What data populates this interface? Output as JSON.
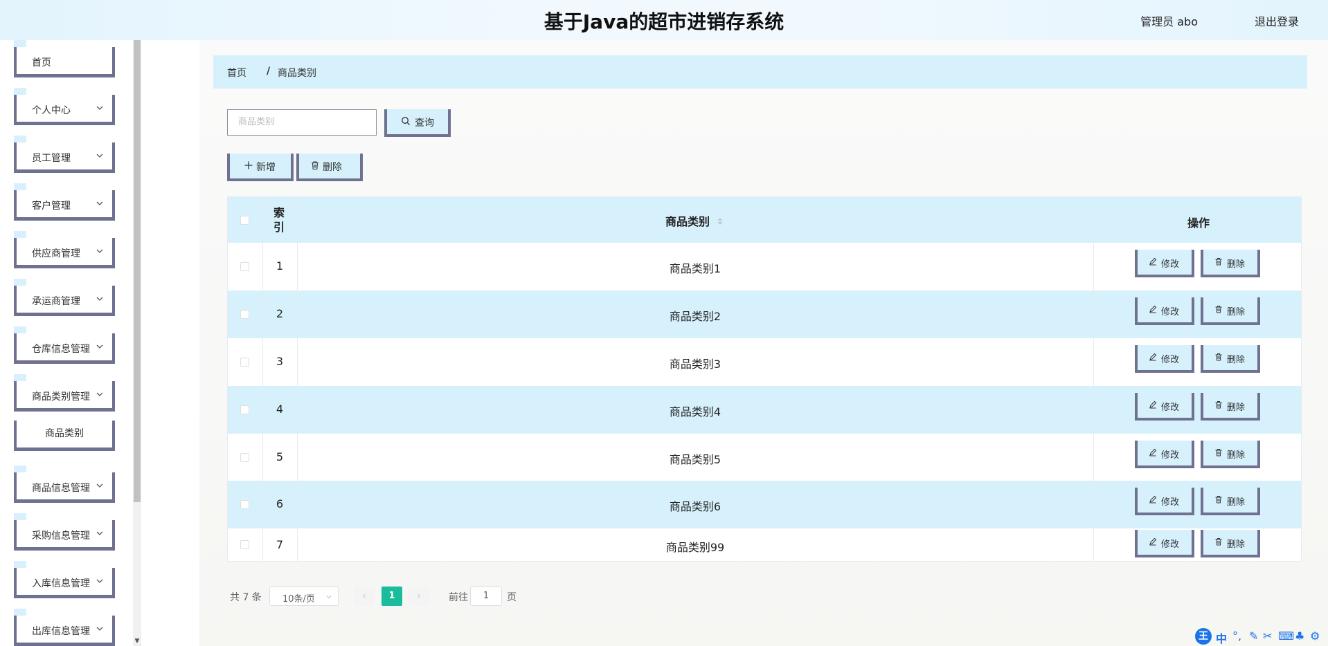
{
  "header": {
    "title": "基于Java的超市进销存系统",
    "user": "管理员 abo",
    "logout": "退出登录"
  },
  "sidebar": {
    "items": [
      {
        "label": "首页"
      },
      {
        "label": "个人中心"
      },
      {
        "label": "员工管理"
      },
      {
        "label": "客户管理"
      },
      {
        "label": "供应商管理"
      },
      {
        "label": "承运商管理"
      },
      {
        "label": "仓库信息管理"
      },
      {
        "label": "商品类别管理"
      },
      {
        "label": "商品类别"
      },
      {
        "label": "商品信息管理"
      },
      {
        "label": "采购信息管理"
      },
      {
        "label": "入库信息管理"
      },
      {
        "label": "出库信息管理"
      }
    ]
  },
  "breadcrumb": {
    "home": "首页",
    "sep": "/",
    "current": "商品类别"
  },
  "search": {
    "placeholder": "商品类别",
    "button": "查询"
  },
  "toolbar": {
    "add": "新增",
    "delete": "删除"
  },
  "table": {
    "headers": {
      "index": "索引",
      "category": "商品类别",
      "actions": "操作"
    },
    "rows": [
      {
        "index": "1",
        "category": "商品类别1"
      },
      {
        "index": "2",
        "category": "商品类别2"
      },
      {
        "index": "3",
        "category": "商品类别3"
      },
      {
        "index": "4",
        "category": "商品类别4"
      },
      {
        "index": "5",
        "category": "商品类别5"
      },
      {
        "index": "6",
        "category": "商品类别6"
      },
      {
        "index": "7",
        "category": "商品类别99"
      }
    ],
    "edit_label": "修改",
    "delete_label": "删除"
  },
  "pagination": {
    "total": "共 7 条",
    "page_size": "10条/页",
    "current_page": "1",
    "goto_prefix": "前往",
    "goto_value": "1",
    "goto_suffix": "页"
  },
  "ime": {
    "logo": "王",
    "mode": "中"
  },
  "colors": {
    "header_bg": "#e3f4fd",
    "accent_bg": "#d7f1fc",
    "border_accent": "#6f7191",
    "page_active": "#1abc9c"
  }
}
